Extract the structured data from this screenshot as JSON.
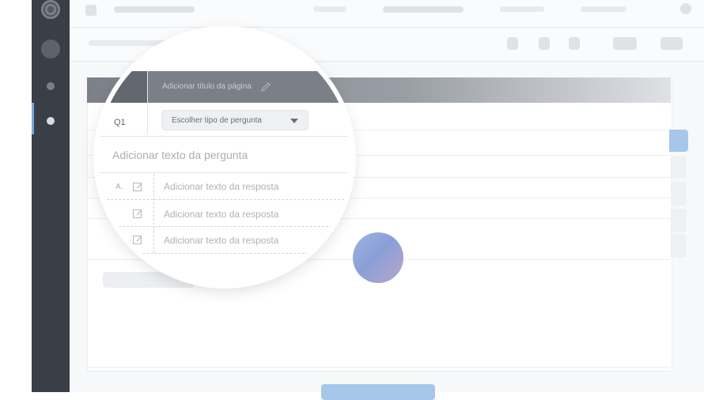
{
  "colors": {
    "rail": "#3a3f47",
    "header": "#7b7f88",
    "accent_blue": "#a7c7ea",
    "placeholder_text": "#a9adb3"
  },
  "page_header": {
    "title_placeholder": "Adicionar título da página",
    "edit_icon": "pencil-icon"
  },
  "question": {
    "number": "Q1",
    "type_select_label": "Escolher tipo de pergunta",
    "type_select_icon": "caret-down-icon",
    "text_placeholder": "Adicionar texto da pergunta"
  },
  "answers": [
    {
      "letter": "A.",
      "icon": "edit-note-icon",
      "placeholder": "Adicionar texto da resposta"
    },
    {
      "letter": "",
      "icon": "edit-note-icon",
      "placeholder": "Adicionar texto da resposta"
    },
    {
      "letter": "",
      "icon": "edit-note-icon",
      "placeholder": "Adicionar texto da resposta"
    }
  ]
}
